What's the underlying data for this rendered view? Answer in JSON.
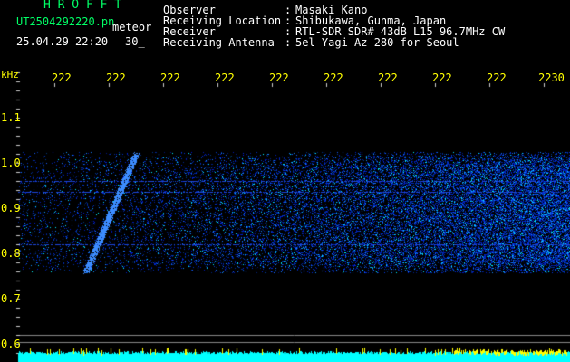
{
  "header": {
    "app_title": "H R O F F T",
    "file_name": "UT2504292220.pn",
    "mode_label": "meteor",
    "date_time": "25.04.29 22:20",
    "interval": "30_"
  },
  "meta": [
    {
      "key": "Observer",
      "value": "Masaki Kano"
    },
    {
      "key": "Receiving Location",
      "value": "Shibukawa, Gunma, Japan"
    },
    {
      "key": "Receiver",
      "value": "RTL-SDR SDR# 43dB L15 96.7MHz CW"
    },
    {
      "key": "Receiving Antenna",
      "value": "5el Yagi Az 280 for Seoul"
    }
  ],
  "separator": ":",
  "axis": {
    "unit": "kHz",
    "time_ticks": [
      "222",
      "222",
      "222",
      "222",
      "222",
      "222",
      "222",
      "222",
      "222",
      "2230"
    ],
    "freq_ticks": [
      "1.1",
      "1.0",
      "0.9",
      "0.8",
      "0.7",
      "0.6"
    ]
  },
  "colors": {
    "background": "#000000",
    "header_green": "#00ff66",
    "axis_yellow": "#ffff00",
    "signal_blue": "#0033ff",
    "signal_cyan": "#00ffff",
    "strip_cyan": "#00ffff",
    "strip_yellow": "#ffff00"
  }
}
